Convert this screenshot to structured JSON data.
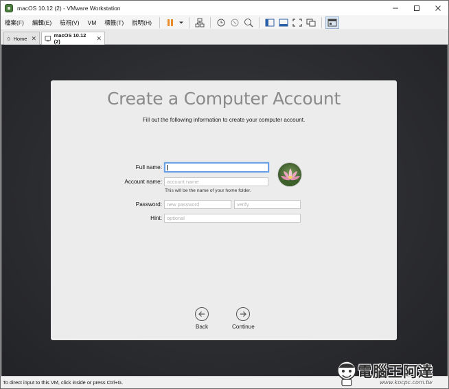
{
  "window": {
    "title": "macOS 10.12 (2) - VMware Workstation"
  },
  "menu": {
    "items": [
      "檔案(F)",
      "編輯(E)",
      "檢視(V)",
      "VM",
      "標籤(T)",
      "說明(H)"
    ]
  },
  "toolbar": {
    "icons": [
      "pause-icon",
      "dropdown-arrow-icon",
      "network-icon",
      "snapshot-icon",
      "snapshot-revert-icon",
      "snapshot-manager-icon",
      "sidebar-view-icon",
      "console-view-icon",
      "full-screen-icon",
      "unity-icon",
      "thumbnail-view-icon"
    ]
  },
  "tabs": [
    {
      "label": "Home",
      "active": false
    },
    {
      "label": "macOS 10.12 (2)",
      "active": true
    }
  ],
  "setup": {
    "title": "Create a Computer Account",
    "subtitle": "Fill out the following information to create your computer account.",
    "full_name_label": "Full name:",
    "account_name_label": "Account name:",
    "account_name_placeholder": "account name",
    "account_name_hint": "This will be the name of your home folder.",
    "password_label": "Password:",
    "password_placeholder": "new password",
    "verify_placeholder": "verify",
    "hint_label": "Hint:",
    "hint_placeholder": "optional",
    "back_label": "Back",
    "continue_label": "Continue"
  },
  "status": {
    "text": "To direct input to this VM, click inside or press Ctrl+G."
  },
  "watermark": {
    "text": "電腦王阿達",
    "url": "www.kocpc.com.tw"
  },
  "colors": {
    "accent_focus": "#6aa1e6",
    "pause_orange": "#e98b2a",
    "vm_background": "#2e2f33",
    "panel_bg": "#ececec"
  }
}
